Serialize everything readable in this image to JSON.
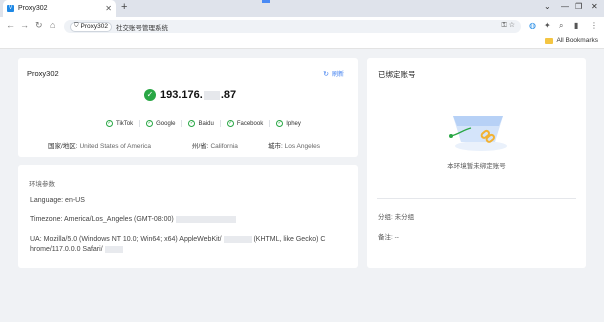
{
  "browser": {
    "tab_title": "Proxy302",
    "tab_favicon": "V",
    "chip_label": "Proxy302",
    "url_text": "社交账号管理系统",
    "bookmarks_label": "All Bookmarks"
  },
  "proxy_card": {
    "title": "Proxy302",
    "refresh_label": "刷新",
    "ip_prefix": "193.176.",
    "ip_suffix": ".87",
    "sites": [
      "TikTok",
      "Google",
      "Baidu",
      "Facebook",
      "Iphey"
    ],
    "country_label": "国家/地区:",
    "country_value": "United States of America",
    "state_label": "州/省:",
    "state_value": "California",
    "city_label": "城市:",
    "city_value": "Los Angeles"
  },
  "env_card": {
    "title": "环境参数",
    "language_label": "Language:",
    "language_value": "en-US",
    "timezone_label": "Timezone:",
    "timezone_value": "America/Los_Angeles (GMT-08:00)",
    "ua_label": "UA:",
    "ua_line1a": "Mozilla/5.0 (Windows NT 10.0; Win64; x64) AppleWebKit/",
    "ua_line1b": "(KHTML, like Gecko) C",
    "ua_line2": "hrome/117.0.0.0 Safari/"
  },
  "bound_card": {
    "title": "已绑定账号",
    "empty_text": "本环境暂未绑定账号",
    "group_label": "分组:",
    "group_value": "未分组",
    "note_label": "备注:",
    "note_value": "--"
  },
  "colors": {
    "accent": "#3d7ef0",
    "success": "#29a745"
  }
}
